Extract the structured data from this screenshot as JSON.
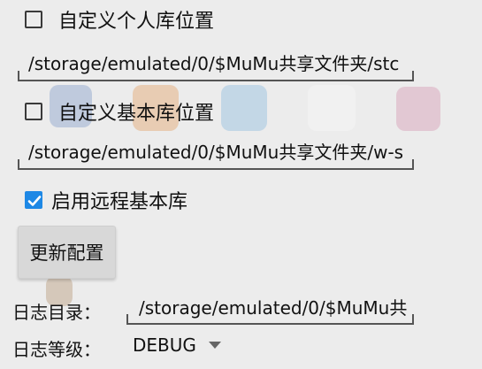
{
  "settings": {
    "custom_personal_repo": {
      "label": "自定义个人库位置",
      "checked": false,
      "path": "/storage/emulated/0/$MuMu共享文件夹/stc"
    },
    "custom_base_repo": {
      "label": "自定义基本库位置",
      "checked": false,
      "path": "/storage/emulated/0/$MuMu共享文件夹/w-s"
    },
    "remote_base_repo": {
      "label": "启用远程基本库",
      "checked": true
    },
    "update_button": "更新配置",
    "log_dir": {
      "label": "日志目录：",
      "value": "/storage/emulated/0/$MuMu共"
    },
    "log_level": {
      "label": "日志等级：",
      "value": "DEBUG"
    }
  },
  "colors": {
    "accent": "#1e88e5",
    "background": "#ececec"
  },
  "icons": {
    "check": "check-icon",
    "dropdown": "dropdown-arrow-icon"
  }
}
